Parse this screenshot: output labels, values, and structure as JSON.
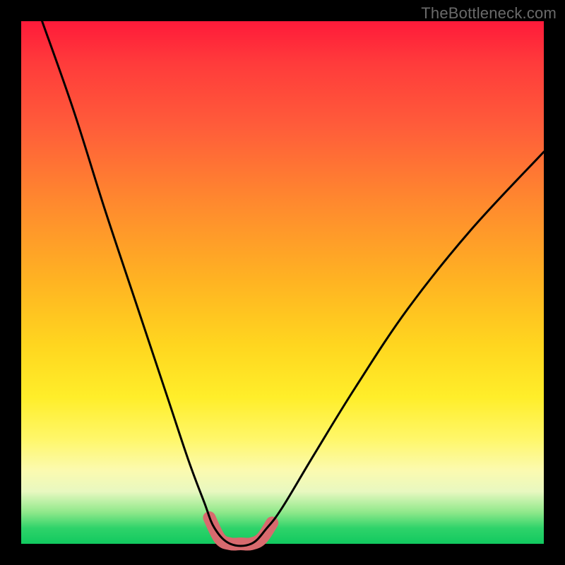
{
  "watermark": "TheBottleneck.com",
  "chart_data": {
    "type": "line",
    "title": "",
    "xlabel": "",
    "ylabel": "",
    "xlim": [
      0,
      100
    ],
    "ylim": [
      0,
      100
    ],
    "grid": false,
    "legend": false,
    "background_gradient": {
      "direction": "vertical",
      "stops": [
        {
          "pos": 0.0,
          "color": "#ff1a3a"
        },
        {
          "pos": 0.5,
          "color": "#ffb422"
        },
        {
          "pos": 0.8,
          "color": "#fff76a"
        },
        {
          "pos": 1.0,
          "color": "#11c95f"
        }
      ]
    },
    "series": [
      {
        "name": "bottleneck-curve",
        "stroke": "#000000",
        "points": [
          {
            "x": 4,
            "y": 100
          },
          {
            "x": 10,
            "y": 83
          },
          {
            "x": 16,
            "y": 64
          },
          {
            "x": 22,
            "y": 46
          },
          {
            "x": 28,
            "y": 28
          },
          {
            "x": 32,
            "y": 16
          },
          {
            "x": 35,
            "y": 8
          },
          {
            "x": 37,
            "y": 3
          },
          {
            "x": 40,
            "y": 0
          },
          {
            "x": 44,
            "y": 0
          },
          {
            "x": 47,
            "y": 3
          },
          {
            "x": 50,
            "y": 7
          },
          {
            "x": 56,
            "y": 17
          },
          {
            "x": 64,
            "y": 30
          },
          {
            "x": 74,
            "y": 45
          },
          {
            "x": 86,
            "y": 60
          },
          {
            "x": 100,
            "y": 75
          }
        ]
      },
      {
        "name": "trough-highlight",
        "stroke": "#d86a6e",
        "stroke_width_px": 18,
        "points": [
          {
            "x": 36,
            "y": 5
          },
          {
            "x": 38,
            "y": 1
          },
          {
            "x": 40,
            "y": 0
          },
          {
            "x": 42,
            "y": 0
          },
          {
            "x": 44,
            "y": 0
          },
          {
            "x": 46,
            "y": 1
          },
          {
            "x": 48,
            "y": 4
          }
        ]
      }
    ]
  }
}
